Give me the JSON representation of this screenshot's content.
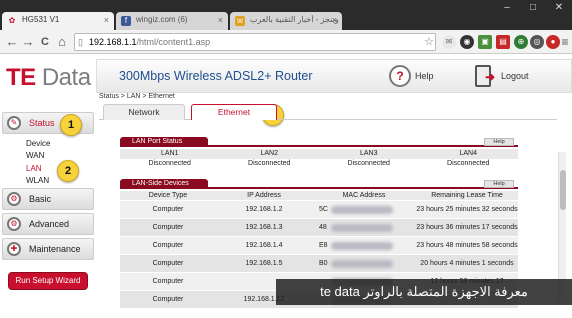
{
  "browser": {
    "tabs": [
      {
        "title": "HG531 V1",
        "favicon_color": "#c8102e",
        "active": true
      },
      {
        "title": "wingiz.com (6)",
        "favicon_color": "#3b5998",
        "active": false
      },
      {
        "title": "وينجز - أخبار التقنية بالعرب",
        "favicon_color": "#e0a020",
        "active": false
      }
    ],
    "window_controls": [
      "–",
      "□",
      "✕"
    ],
    "nav": {
      "back": "←",
      "forward": "→",
      "reload": "C",
      "home": "⌂"
    },
    "address": {
      "host": "192.168.1.1",
      "path": "/html/content1.asp"
    },
    "extensions": [
      {
        "name": "star-icon",
        "glyph": "☆",
        "color": "#777"
      },
      {
        "name": "email-icon",
        "glyph": "✉",
        "color": "#777"
      },
      {
        "name": "glasses-icon",
        "glyph": "◉",
        "color": "#333"
      },
      {
        "name": "wallet-icon",
        "glyph": "▣",
        "color": "#4a8f3c"
      },
      {
        "name": "pdf-icon",
        "glyph": "▤",
        "color": "#c62828"
      },
      {
        "name": "green-ext-icon",
        "glyph": "⊕",
        "color": "#2e7d32"
      },
      {
        "name": "grey-ext-icon",
        "glyph": "◎",
        "color": "#555"
      },
      {
        "name": "red-ext-icon",
        "glyph": "●",
        "color": "#c62828"
      },
      {
        "name": "menu-icon",
        "glyph": "≡",
        "color": "#555"
      }
    ]
  },
  "router": {
    "logo_te": "TE",
    "logo_data": "Data",
    "title": "300Mbps Wireless ADSL2+ Router",
    "help_label": "Help",
    "logout_label": "Logout"
  },
  "sidebar": {
    "status": "Status",
    "sub_items": [
      "Device",
      "WAN",
      "LAN",
      "WLAN"
    ],
    "basic": "Basic",
    "advanced": "Advanced",
    "maintenance": "Maintenance",
    "setup_wizard": "Run Setup Wizard"
  },
  "breadcrumb": "Status > LAN > Ethernet",
  "subtabs": {
    "network": "Network",
    "ethernet": "Ethernet"
  },
  "lan_port_status": {
    "title": "LAN Port Status",
    "help": "Help",
    "headers": [
      "LAN1",
      "LAN2",
      "LAN3",
      "LAN4"
    ],
    "values": [
      "Disconnected",
      "Disconnected",
      "Disconnected",
      "Disconnected"
    ]
  },
  "lan_side_devices": {
    "title": "LAN-Side Devices",
    "help": "Help",
    "headers": [
      "Device Type",
      "IP Address",
      "MAC Address",
      "Remaining Lease Time"
    ],
    "rows": [
      {
        "type": "Computer",
        "ip": "192.168.1.2",
        "mac": "5C",
        "lease": "23 hours 25 minutes 32 seconds"
      },
      {
        "type": "Computer",
        "ip": "192.168.1.3",
        "mac": "48",
        "lease": "23 hours 36 minutes 17 seconds"
      },
      {
        "type": "Computer",
        "ip": "192.168.1.4",
        "mac": "E8",
        "lease": "23 hours 48 minutes 58 seconds"
      },
      {
        "type": "Computer",
        "ip": "192.168.1.5",
        "mac": "B0",
        "lease": "20 hours 4 minutes 1 seconds"
      },
      {
        "type": "Computer",
        "ip": "",
        "mac": "",
        "lease": "12 hours 58 minutes 17"
      },
      {
        "type": "Computer",
        "ip": "192.168.1.12",
        "mac": "",
        "lease": ""
      }
    ]
  },
  "annotations": [
    "1",
    "2",
    "3"
  ],
  "caption": "معرفة الاجهزة المتصلة بالراوتر te data"
}
